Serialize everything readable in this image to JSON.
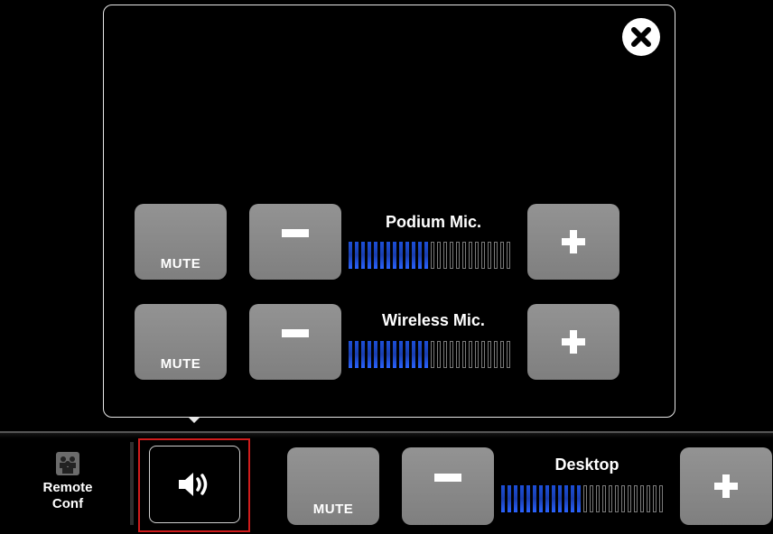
{
  "popup": {
    "close_icon": "close-x-icon",
    "channels": [
      {
        "name": "Podium Mic.",
        "mute_label": "MUTE",
        "level": 0.5
      },
      {
        "name": "Wireless Mic.",
        "mute_label": "MUTE",
        "level": 0.5
      }
    ]
  },
  "bottom_bar": {
    "remote_conf": {
      "line1": "Remote",
      "line2": "Conf",
      "icon": "conference-icon"
    },
    "volume_button_icon": "speaker-icon",
    "desktop": {
      "name": "Desktop",
      "mute_label": "MUTE",
      "level": 0.5
    }
  },
  "colors": {
    "meter_on": "#1c4fd8",
    "selected_outline": "#d01c1c",
    "button_gray": "#8a8a8a"
  }
}
